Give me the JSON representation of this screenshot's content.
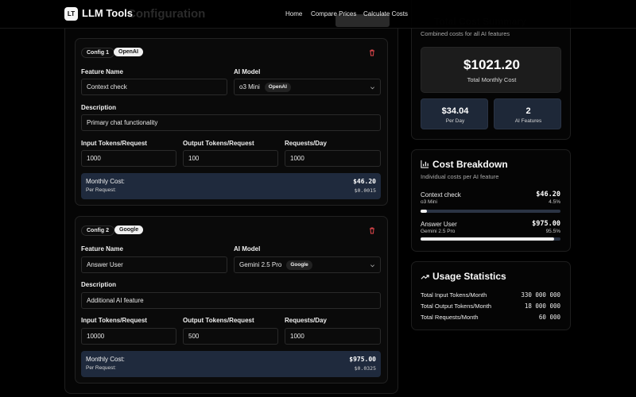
{
  "header": {
    "logo_initials": "LT",
    "app_name": "LLM Tools",
    "nav": [
      "Home",
      "Compare Prices",
      "Calculate Costs"
    ]
  },
  "configs": [
    {
      "tag": "Config 1",
      "provider": "OpenAI",
      "feature_name_label": "Feature Name",
      "feature_name": "Context check",
      "model_label": "AI Model",
      "model": "o3 Mini",
      "model_provider": "OpenAI",
      "description_label": "Description",
      "description": "Primary chat functionality",
      "input_tokens_label": "Input Tokens/Request",
      "input_tokens": "1000",
      "output_tokens_label": "Output Tokens/Request",
      "output_tokens": "100",
      "requests_label": "Requests/Day",
      "requests": "1000",
      "monthly_cost_label": "Monthly Cost:",
      "monthly_cost": "$46.20",
      "per_request_label": "Per Request:",
      "per_request": "$0.0015"
    },
    {
      "tag": "Config 2",
      "provider": "Google",
      "feature_name_label": "Feature Name",
      "feature_name": "Answer User",
      "model_label": "AI Model",
      "model": "Gemini 2.5 Pro",
      "model_provider": "Google",
      "description_label": "Description",
      "description": "Additional AI feature",
      "input_tokens_label": "Input Tokens/Request",
      "input_tokens": "10000",
      "output_tokens_label": "Output Tokens/Request",
      "output_tokens": "500",
      "requests_label": "Requests/Day",
      "requests": "1000",
      "monthly_cost_label": "Monthly Cost:",
      "monthly_cost": "$975.00",
      "per_request_label": "Per Request:",
      "per_request": "$0.0325"
    }
  ],
  "summary": {
    "subtitle": "Combined costs for all AI features",
    "total_value": "$1021.20",
    "total_label": "Total Monthly Cost",
    "per_day_value": "$34.04",
    "per_day_label": "Per Day",
    "features_value": "2",
    "features_label": "AI Features"
  },
  "breakdown": {
    "title": "Cost Breakdown",
    "subtitle": "Individual costs per AI feature",
    "items": [
      {
        "name": "Context check",
        "model": "o3 Mini",
        "cost": "$46.20",
        "percent": "4.5%",
        "fraction": 0.045
      },
      {
        "name": "Answer User",
        "model": "Gemini 2.5 Pro",
        "cost": "$975.00",
        "percent": "95.5%",
        "fraction": 0.955
      }
    ]
  },
  "usage": {
    "title": "Usage Statistics",
    "rows": [
      {
        "label": "Total Input Tokens/Month",
        "value": "330 000 000"
      },
      {
        "label": "Total Output Tokens/Month",
        "value": "18 000 000"
      },
      {
        "label": "Total Requests/Month",
        "value": "60 000"
      }
    ]
  },
  "colors": {
    "background": "#000000",
    "cost_bar": "#1f2a3d",
    "danger": "#e5484d",
    "progress_track": "#2b3444"
  }
}
